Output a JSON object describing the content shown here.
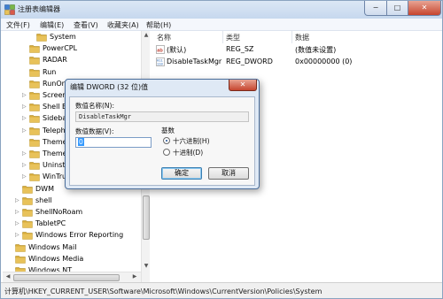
{
  "window": {
    "title": "注册表编辑器",
    "minimize": "−",
    "maximize": "□",
    "close": "✕"
  },
  "menu": [
    "文件(F)",
    "编辑(E)",
    "查看(V)",
    "收藏夹(A)",
    "帮助(H)"
  ],
  "tree": [
    {
      "label": "System",
      "indent": 2,
      "expander": "",
      "selected": false
    },
    {
      "label": "PowerCPL",
      "indent": 1,
      "expander": "",
      "selected": false
    },
    {
      "label": "RADAR",
      "indent": 1,
      "expander": "",
      "selected": false
    },
    {
      "label": "Run",
      "indent": 1,
      "expander": "",
      "selected": false
    },
    {
      "label": "RunOnce",
      "indent": 1,
      "expander": "",
      "selected": false
    },
    {
      "label": "Screensavers",
      "indent": 1,
      "expander": "▷",
      "selected": false
    },
    {
      "label": "Shell Extensions",
      "indent": 1,
      "expander": "▷",
      "selected": false
    },
    {
      "label": "Sidebar",
      "indent": 1,
      "expander": "▷",
      "selected": false
    },
    {
      "label": "Telephony",
      "indent": 1,
      "expander": "▷",
      "selected": false
    },
    {
      "label": "ThemeManager",
      "indent": 1,
      "expander": "",
      "selected": false
    },
    {
      "label": "Themes",
      "indent": 1,
      "expander": "▷",
      "selected": false
    },
    {
      "label": "Uninstall",
      "indent": 1,
      "expander": "▷",
      "selected": false
    },
    {
      "label": "WinTrust",
      "indent": 1,
      "expander": "▷",
      "selected": false
    },
    {
      "label": "DWM",
      "indent": 0,
      "expander": "",
      "selected": false
    },
    {
      "label": "shell",
      "indent": 0,
      "expander": "▷",
      "selected": false
    },
    {
      "label": "ShellNoRoam",
      "indent": 0,
      "expander": "▷",
      "selected": false
    },
    {
      "label": "TabletPC",
      "indent": 0,
      "expander": "▷",
      "selected": false
    },
    {
      "label": "Windows Error Reporting",
      "indent": 0,
      "expander": "▷",
      "selected": false
    },
    {
      "label": "Windows Mail",
      "indent": -1,
      "expander": "",
      "selected": false
    },
    {
      "label": "Windows Media",
      "indent": -1,
      "expander": "",
      "selected": false
    },
    {
      "label": "Windows NT",
      "indent": -1,
      "expander": "",
      "selected": false
    }
  ],
  "list": {
    "headers": {
      "name": "名称",
      "type": "类型",
      "data": "数据"
    },
    "rows": [
      {
        "name": "(默认)",
        "type": "REG_SZ",
        "data": "(数值未设置)",
        "icon": "string-value-icon"
      },
      {
        "name": "DisableTaskMgr",
        "type": "REG_DWORD",
        "data": "0x00000000 (0)",
        "icon": "dword-value-icon"
      }
    ]
  },
  "status": {
    "path": "计算机\\HKEY_CURRENT_USER\\Software\\Microsoft\\Windows\\CurrentVersion\\Policies\\System"
  },
  "dialog": {
    "title": "编辑 DWORD (32 位)值",
    "close": "✕",
    "name_label": "数值名称(N):",
    "name_value": "DisableTaskMgr",
    "data_label": "数值数据(V):",
    "data_value": "0",
    "radix_label": "基数",
    "radix_options": [
      {
        "label": "十六进制(H)",
        "checked": true
      },
      {
        "label": "十进制(D)",
        "checked": false
      }
    ],
    "ok": "确定",
    "cancel": "取消"
  },
  "colors": {
    "selection": "#3399ff",
    "folder": "#e8c25a",
    "close_red": "#c6452f"
  }
}
